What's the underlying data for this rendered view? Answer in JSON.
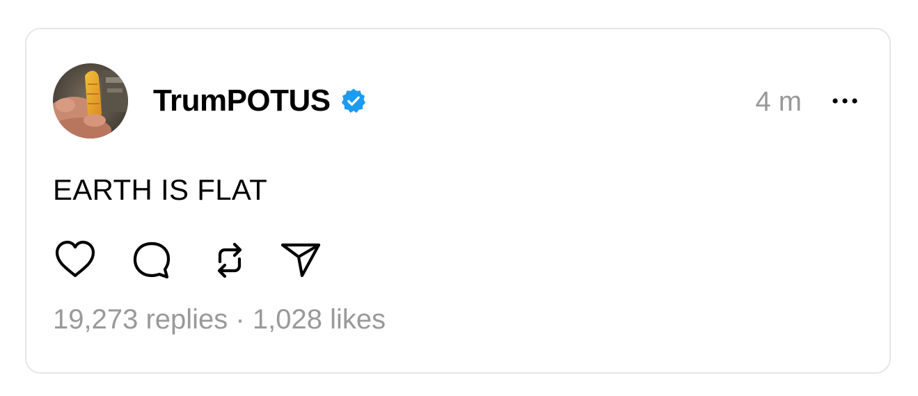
{
  "post": {
    "author": {
      "username": "TrumPOTUS",
      "verified": true,
      "avatar_icon": "avatar-photo"
    },
    "timestamp": "4 m",
    "more_icon": "ellipsis-icon",
    "text": "EARTH IS FLAT",
    "actions": [
      {
        "name": "like",
        "icon": "heart-icon"
      },
      {
        "name": "reply",
        "icon": "speech-bubble-icon"
      },
      {
        "name": "repost",
        "icon": "repost-icon"
      },
      {
        "name": "share",
        "icon": "paper-plane-icon"
      }
    ],
    "stats": {
      "replies": "19,273 replies",
      "separator": "·",
      "likes": "1,028 likes"
    }
  },
  "colors": {
    "verified_badge": "#1d9bf0",
    "muted_text": "#999999",
    "card_border": "#e6e6e6"
  }
}
